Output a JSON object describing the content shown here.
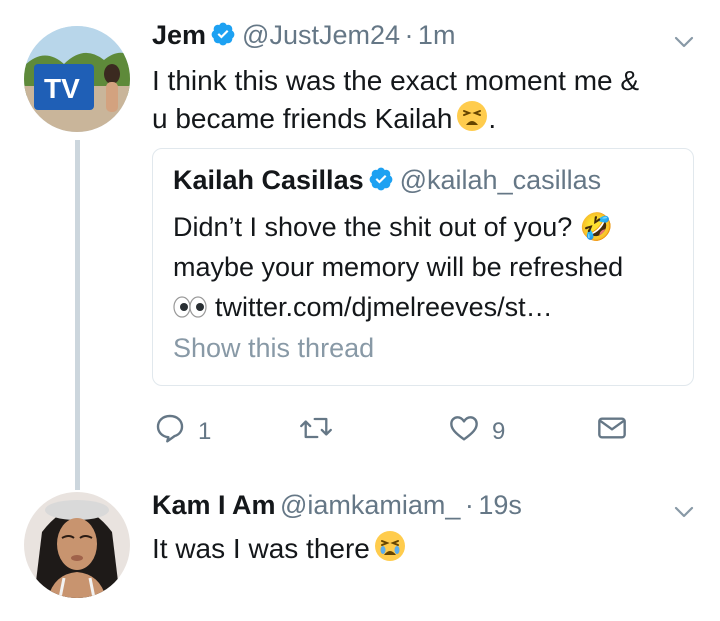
{
  "tweet1": {
    "name": "Jem",
    "handle": "@JustJem24",
    "separator": "·",
    "time": "1m",
    "text_line1": "I think this was the exact moment me &",
    "text_line2": "u became friends Kailah",
    "text_end": ".",
    "quote": {
      "name": "Kailah Casillas",
      "handle": "@kailah_casillas",
      "line1": "Didn’t I shove the shit out of you? 🤣",
      "line2": "maybe your memory will be refreshed",
      "line3": "twitter.com/djmelreeves/st…",
      "thread_link": "Show this thread"
    },
    "actions": {
      "reply_count": "1",
      "retweet_count": "",
      "like_count": "9"
    }
  },
  "tweet2": {
    "name": "Kam I Am",
    "handle": "@iamkamiam_",
    "separator": "·",
    "time": "19s",
    "text": "It was I was there"
  },
  "colors": {
    "verified": "#1da1f2",
    "icon_gray": "#657786",
    "thread_line": "#ccd6dd",
    "border": "#e1e8ed"
  }
}
